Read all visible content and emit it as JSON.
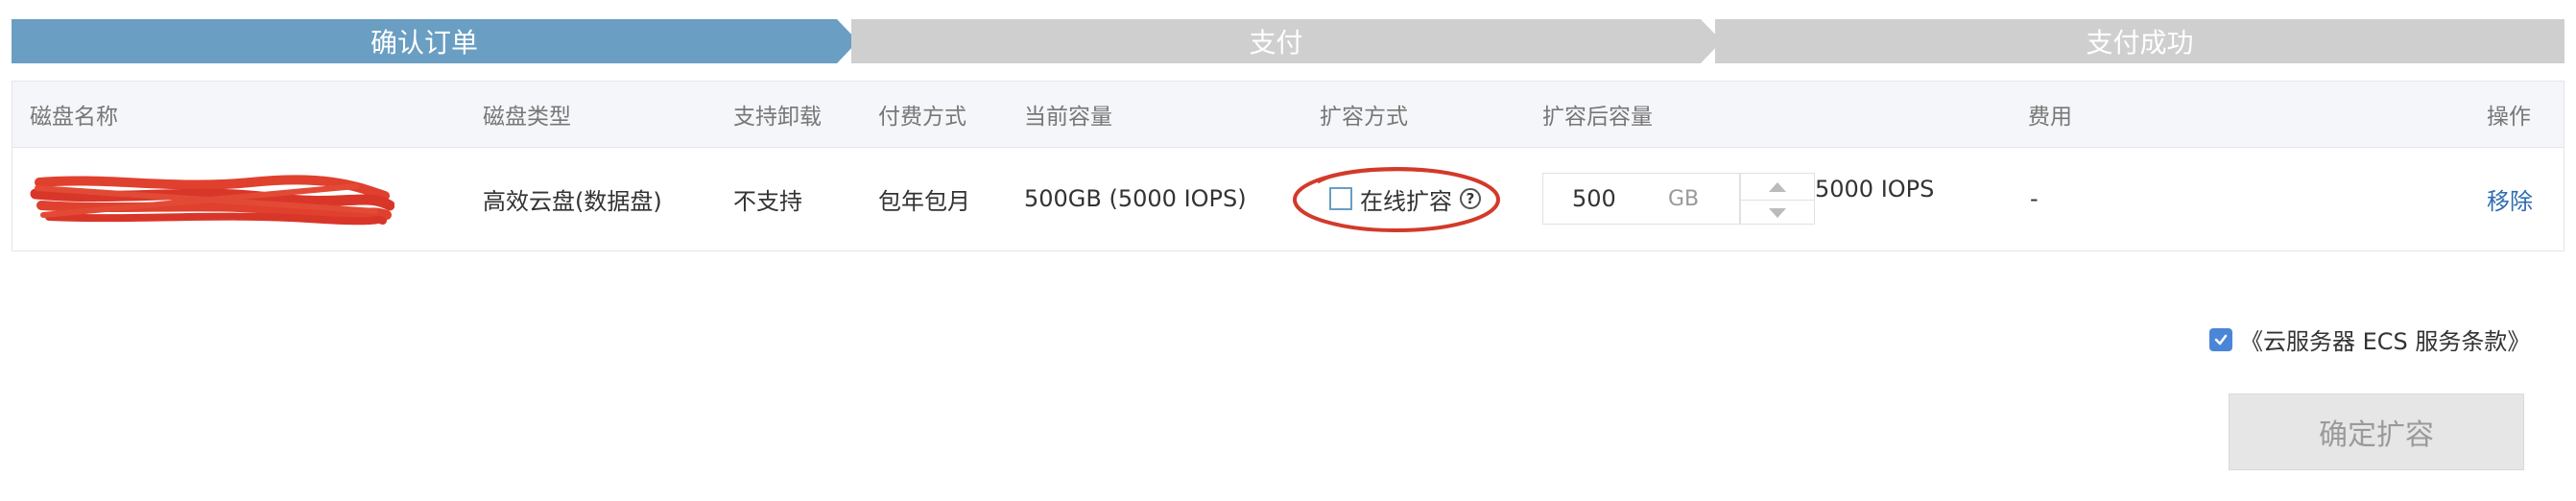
{
  "steps": [
    {
      "label": "确认订单",
      "active": true
    },
    {
      "label": "支付",
      "active": false
    },
    {
      "label": "支付成功",
      "active": false
    }
  ],
  "colors": {
    "active_step": "#6a9ec2",
    "inactive_step": "#cfcfcf",
    "link": "#2d6cb0",
    "annotation": "#d23a2a"
  },
  "table": {
    "headers": {
      "disk_name": "磁盘名称",
      "disk_type": "磁盘类型",
      "detach": "支持卸载",
      "billing": "付费方式",
      "current_capacity": "当前容量",
      "expand_method": "扩容方式",
      "capacity_after": "扩容后容量",
      "fee": "费用",
      "action": "操作"
    },
    "row": {
      "disk_name": "",
      "disk_type": "高效云盘(数据盘)",
      "detach": "不支持",
      "billing": "包年包月",
      "current_capacity": "500GB (5000 IOPS)",
      "online_expand_label": "在线扩容",
      "online_expand_checked": false,
      "capacity_value": "500",
      "capacity_unit": "GB",
      "iops_after": "5000 IOPS",
      "fee": "-",
      "remove_label": "移除"
    }
  },
  "agreement": {
    "checked": true,
    "text": "《云服务器 ECS 服务条款》"
  },
  "confirm_button": "确定扩容"
}
